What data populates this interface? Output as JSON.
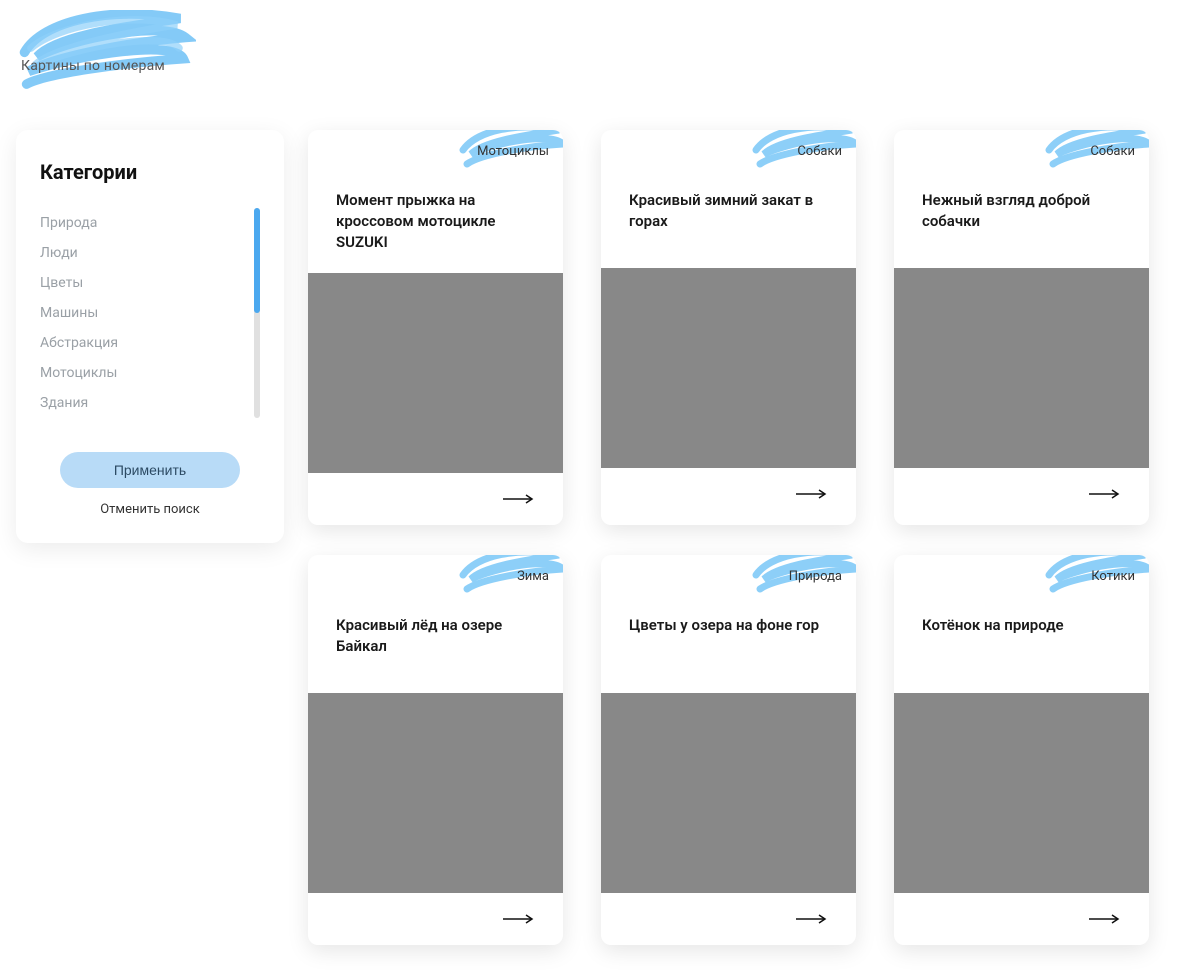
{
  "site": {
    "title": "Картины по номерам"
  },
  "sidebar": {
    "heading": "Категории",
    "categories": [
      "Природа",
      "Люди",
      "Цветы",
      "Машины",
      "Абстракция",
      "Мотоциклы",
      "Здания"
    ],
    "apply": "Применить",
    "cancel": "Отменить поиск"
  },
  "cards": [
    {
      "tag": "Мотоциклы",
      "title": "Момент прыжка на кроссовом мотоцикле SUZUKI",
      "imgClass": "img-motocross"
    },
    {
      "tag": "Собаки",
      "title": "Красивый зимний закат в горах",
      "imgClass": "img-winter-sunset"
    },
    {
      "tag": "Собаки",
      "title": "Нежный взгляд доброй собачки",
      "imgClass": "img-dog"
    },
    {
      "tag": "Зима",
      "title": "Красивый лёд на озере Байкал",
      "imgClass": "img-ice"
    },
    {
      "tag": "Природа",
      "title": "Цветы у озера на фоне гор",
      "imgClass": "img-lake-flowers"
    },
    {
      "tag": "Котики",
      "title": "Котёнок на природе",
      "imgClass": "img-kitten"
    }
  ]
}
